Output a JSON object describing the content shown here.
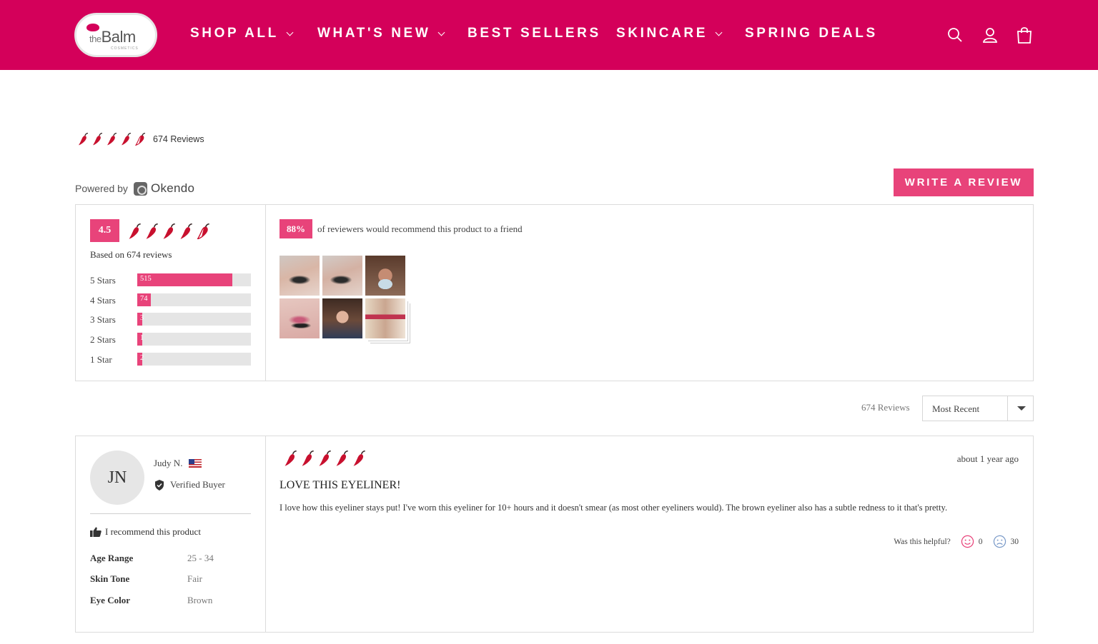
{
  "header": {
    "logo": {
      "word": "Balm",
      "prefix": "the",
      "sub": "COSMETICS"
    },
    "nav": [
      {
        "label": "SHOP ALL",
        "has_dropdown": true
      },
      {
        "label": "WHAT'S NEW",
        "has_dropdown": true
      },
      {
        "label": "BEST SELLERS",
        "has_dropdown": false
      },
      {
        "label": "SKINCARE",
        "has_dropdown": true
      },
      {
        "label": "SPRING DEALS",
        "has_dropdown": false
      }
    ],
    "icons": [
      "search-icon",
      "account-icon",
      "cart-icon"
    ]
  },
  "summary": {
    "top_count": "674 Reviews",
    "powered_by": "Powered by",
    "provider": "Okendo",
    "write_review": "WRITE A REVIEW",
    "average": "4.5",
    "average_rating": 4.5,
    "based_on": "Based on 674 reviews",
    "distribution": [
      {
        "label": "5 Stars",
        "count": "515"
      },
      {
        "label": "4 Stars",
        "count": "74"
      },
      {
        "label": "3 Stars",
        "count": "3"
      },
      {
        "label": "2 Stars",
        "count": "1"
      },
      {
        "label": "1 Star",
        "count": "2"
      }
    ],
    "recommend_pct": "88%",
    "recommend_text": "of reviewers would recommend this product to a friend",
    "photos": [
      "eye-closeup-1",
      "eye-closeup-2",
      "selfie-mask",
      "eye-makeup-pink",
      "selfie-woman",
      "product-stack"
    ]
  },
  "sort": {
    "count": "674 Reviews",
    "selected": "Most Recent"
  },
  "review": {
    "initials": "JN",
    "name": "Judy N.",
    "verified": "Verified Buyer",
    "recommend": "I recommend this product",
    "attributes": [
      {
        "key": "Age Range",
        "value": "25 - 34"
      },
      {
        "key": "Skin Tone",
        "value": "Fair"
      },
      {
        "key": "Eye Color",
        "value": "Brown"
      }
    ],
    "rating": 5,
    "date": "about 1 year ago",
    "title": "LOVE THIS EYELINER!",
    "body": "I love how this eyeliner stays put! I've worn this eyeliner for 10+ hours and it doesn't smear (as most other eyeliners would). The brown eyeliner also has a subtle redness to it that's pretty.",
    "helpful_label": "Was this helpful?",
    "helpful_yes": "0",
    "helpful_no": "30"
  },
  "colors": {
    "brand": "#d4005a",
    "accent": "#e8437a",
    "pepper": "#c8102e",
    "pepper_stem": "#3a2a2a"
  }
}
